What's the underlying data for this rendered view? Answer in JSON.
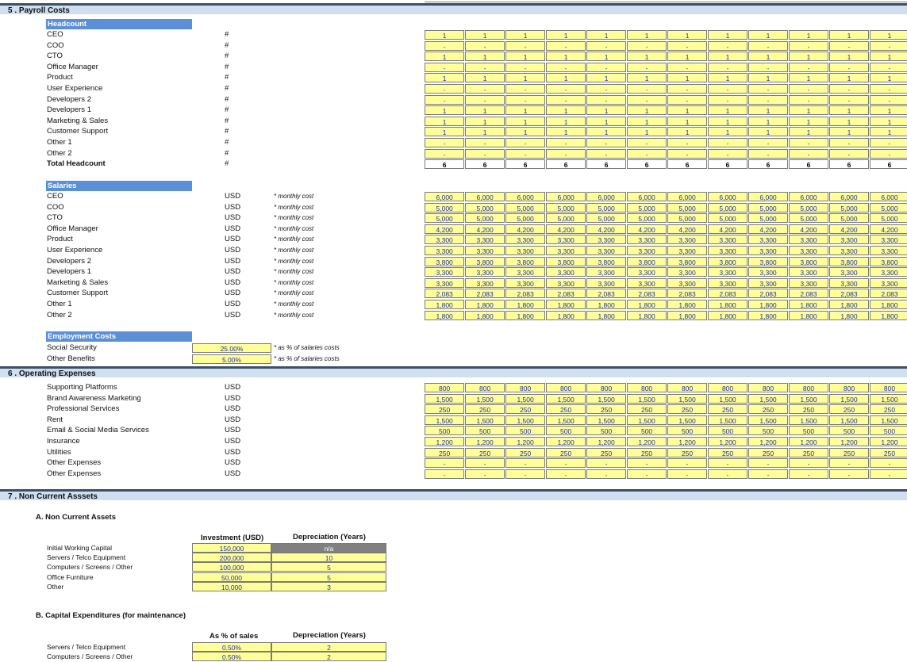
{
  "payroll": {
    "section_title": "5 . Payroll Costs",
    "headcount": {
      "header": "Headcount",
      "unit": "#",
      "rows": [
        {
          "label": "CEO",
          "values": [
            "1",
            "1",
            "1",
            "1",
            "1",
            "1",
            "1",
            "1",
            "1",
            "1",
            "1",
            "1"
          ]
        },
        {
          "label": "COO",
          "values": [
            "-",
            "-",
            "-",
            "-",
            "-",
            "-",
            "-",
            "-",
            "-",
            "-",
            "-",
            "-"
          ]
        },
        {
          "label": "CTO",
          "values": [
            "1",
            "1",
            "1",
            "1",
            "1",
            "1",
            "1",
            "1",
            "1",
            "1",
            "1",
            "1"
          ]
        },
        {
          "label": "Office Manager",
          "values": [
            "-",
            "-",
            "-",
            "-",
            "-",
            "-",
            "-",
            "-",
            "-",
            "-",
            "-",
            "-"
          ]
        },
        {
          "label": "Product",
          "values": [
            "1",
            "1",
            "1",
            "1",
            "1",
            "1",
            "1",
            "1",
            "1",
            "1",
            "1",
            "1"
          ]
        },
        {
          "label": "User Experience",
          "values": [
            "-",
            "-",
            "-",
            "-",
            "-",
            "-",
            "-",
            "-",
            "-",
            "-",
            "-",
            "-"
          ]
        },
        {
          "label": "Developers 2",
          "values": [
            "-",
            "-",
            "-",
            "-",
            "-",
            "-",
            "-",
            "-",
            "-",
            "-",
            "-",
            "-"
          ]
        },
        {
          "label": "Developers 1",
          "values": [
            "1",
            "1",
            "1",
            "1",
            "1",
            "1",
            "1",
            "1",
            "1",
            "1",
            "1",
            "1"
          ]
        },
        {
          "label": "Marketing & Sales",
          "values": [
            "1",
            "1",
            "1",
            "1",
            "1",
            "1",
            "1",
            "1",
            "1",
            "1",
            "1",
            "1"
          ]
        },
        {
          "label": "Customer Support",
          "values": [
            "1",
            "1",
            "1",
            "1",
            "1",
            "1",
            "1",
            "1",
            "1",
            "1",
            "1",
            "1"
          ]
        },
        {
          "label": "Other 1",
          "values": [
            "-",
            "-",
            "-",
            "-",
            "-",
            "-",
            "-",
            "-",
            "-",
            "-",
            "-",
            "-"
          ]
        },
        {
          "label": "Other 2",
          "values": [
            "-",
            "-",
            "-",
            "-",
            "-",
            "-",
            "-",
            "-",
            "-",
            "-",
            "-",
            "-"
          ]
        }
      ],
      "total": {
        "label": "Total Headcount",
        "values": [
          "6",
          "6",
          "6",
          "6",
          "6",
          "6",
          "6",
          "6",
          "6",
          "6",
          "6",
          "6"
        ]
      }
    },
    "salaries": {
      "header": "Salaries",
      "unit": "USD",
      "note": "* monthly cost",
      "rows": [
        {
          "label": "CEO",
          "values": [
            "6,000",
            "6,000",
            "6,000",
            "6,000",
            "6,000",
            "6,000",
            "6,000",
            "6,000",
            "6,000",
            "6,000",
            "6,000",
            "6,000"
          ]
        },
        {
          "label": "COO",
          "values": [
            "5,000",
            "5,000",
            "5,000",
            "5,000",
            "5,000",
            "5,000",
            "5,000",
            "5,000",
            "5,000",
            "5,000",
            "5,000",
            "5,000"
          ]
        },
        {
          "label": "CTO",
          "values": [
            "5,000",
            "5,000",
            "5,000",
            "5,000",
            "5,000",
            "5,000",
            "5,000",
            "5,000",
            "5,000",
            "5,000",
            "5,000",
            "5,000"
          ]
        },
        {
          "label": "Office Manager",
          "values": [
            "4,200",
            "4,200",
            "4,200",
            "4,200",
            "4,200",
            "4,200",
            "4,200",
            "4,200",
            "4,200",
            "4,200",
            "4,200",
            "4,200"
          ]
        },
        {
          "label": "Product",
          "values": [
            "3,300",
            "3,300",
            "3,300",
            "3,300",
            "3,300",
            "3,300",
            "3,300",
            "3,300",
            "3,300",
            "3,300",
            "3,300",
            "3,300"
          ]
        },
        {
          "label": "User Experience",
          "values": [
            "3,300",
            "3,300",
            "3,300",
            "3,300",
            "3,300",
            "3,300",
            "3,300",
            "3,300",
            "3,300",
            "3,300",
            "3,300",
            "3,300"
          ]
        },
        {
          "label": "Developers 2",
          "values": [
            "3,800",
            "3,800",
            "3,800",
            "3,800",
            "3,800",
            "3,800",
            "3,800",
            "3,800",
            "3,800",
            "3,800",
            "3,800",
            "3,800"
          ]
        },
        {
          "label": "Developers 1",
          "values": [
            "3,300",
            "3,300",
            "3,300",
            "3,300",
            "3,300",
            "3,300",
            "3,300",
            "3,300",
            "3,300",
            "3,300",
            "3,300",
            "3,300"
          ]
        },
        {
          "label": "Marketing & Sales",
          "values": [
            "3,300",
            "3,300",
            "3,300",
            "3,300",
            "3,300",
            "3,300",
            "3,300",
            "3,300",
            "3,300",
            "3,300",
            "3,300",
            "3,300"
          ]
        },
        {
          "label": "Customer Support",
          "values": [
            "2,083",
            "2,083",
            "2,083",
            "2,083",
            "2,083",
            "2,083",
            "2,083",
            "2,083",
            "2,083",
            "2,083",
            "2,083",
            "2,083"
          ]
        },
        {
          "label": "Other 1",
          "values": [
            "1,800",
            "1,800",
            "1,800",
            "1,800",
            "1,800",
            "1,800",
            "1,800",
            "1,800",
            "1,800",
            "1,800",
            "1,800",
            "1,800"
          ]
        },
        {
          "label": "Other 2",
          "values": [
            "1,800",
            "1,800",
            "1,800",
            "1,800",
            "1,800",
            "1,800",
            "1,800",
            "1,800",
            "1,800",
            "1,800",
            "1,800",
            "1,800"
          ]
        }
      ]
    },
    "employment": {
      "header": "Employment Costs",
      "note": "* as % of salaries costs",
      "rows": [
        {
          "label": "Social Security",
          "value": "25.00%"
        },
        {
          "label": "Other Benefits",
          "value": "5.00%"
        }
      ]
    }
  },
  "opex": {
    "section_title": "6 . Operating Expenses",
    "unit": "USD",
    "rows": [
      {
        "label": "Supporting Platforms",
        "values": [
          "800",
          "800",
          "800",
          "800",
          "800",
          "800",
          "800",
          "800",
          "800",
          "800",
          "800",
          "800"
        ]
      },
      {
        "label": "Brand Awareness Marketing",
        "values": [
          "1,500",
          "1,500",
          "1,500",
          "1,500",
          "1,500",
          "1,500",
          "1,500",
          "1,500",
          "1,500",
          "1,500",
          "1,500",
          "1,500"
        ]
      },
      {
        "label": "Professional Services",
        "values": [
          "250",
          "250",
          "250",
          "250",
          "250",
          "250",
          "250",
          "250",
          "250",
          "250",
          "250",
          "250"
        ]
      },
      {
        "label": "Rent",
        "values": [
          "1,500",
          "1,500",
          "1,500",
          "1,500",
          "1,500",
          "1,500",
          "1,500",
          "1,500",
          "1,500",
          "1,500",
          "1,500",
          "1,500"
        ]
      },
      {
        "label": "Email & Social Media Services",
        "values": [
          "500",
          "500",
          "500",
          "500",
          "500",
          "500",
          "500",
          "500",
          "500",
          "500",
          "500",
          "500"
        ]
      },
      {
        "label": "Insurance",
        "values": [
          "1,200",
          "1,200",
          "1,200",
          "1,200",
          "1,200",
          "1,200",
          "1,200",
          "1,200",
          "1,200",
          "1,200",
          "1,200",
          "1,200"
        ]
      },
      {
        "label": "Utilities",
        "values": [
          "250",
          "250",
          "250",
          "250",
          "250",
          "250",
          "250",
          "250",
          "250",
          "250",
          "250",
          "250"
        ]
      },
      {
        "label": "Other Expenses",
        "values": [
          "-",
          "-",
          "-",
          "-",
          "-",
          "-",
          "-",
          "-",
          "-",
          "-",
          "-",
          "-"
        ]
      },
      {
        "label": "Other Expenses",
        "values": [
          "-",
          "-",
          "-",
          "-",
          "-",
          "-",
          "-",
          "-",
          "-",
          "-",
          "-",
          "-"
        ]
      }
    ]
  },
  "nca": {
    "section_title": "7 . Non Current Asssets",
    "a_title": "A.  Non Current Assets",
    "a_col1": "Investment (USD)",
    "a_col2": "Depreciation (Years)",
    "a_rows": [
      {
        "label": "Initial Working Capital",
        "investment": "150,000",
        "depreciation": "n/a"
      },
      {
        "label": "Servers / Telco Equipment",
        "investment": "200,000",
        "depreciation": "10"
      },
      {
        "label": "Computers / Screens / Other",
        "investment": "100,000",
        "depreciation": "5"
      },
      {
        "label": "Office Furniture",
        "investment": "50,000",
        "depreciation": "5"
      },
      {
        "label": "Other",
        "investment": "10,000",
        "depreciation": "3"
      }
    ],
    "b_title": "B.  Capital Expenditures (for maintenance)",
    "b_col1": "As % of sales",
    "b_col2": "Depreciation (Years)",
    "b_rows": [
      {
        "label": "Servers / Telco Equipment",
        "pct": "0.50%",
        "depreciation": "2"
      },
      {
        "label": "Computers / Screens / Other",
        "pct": "0.50%",
        "depreciation": "2"
      }
    ]
  }
}
